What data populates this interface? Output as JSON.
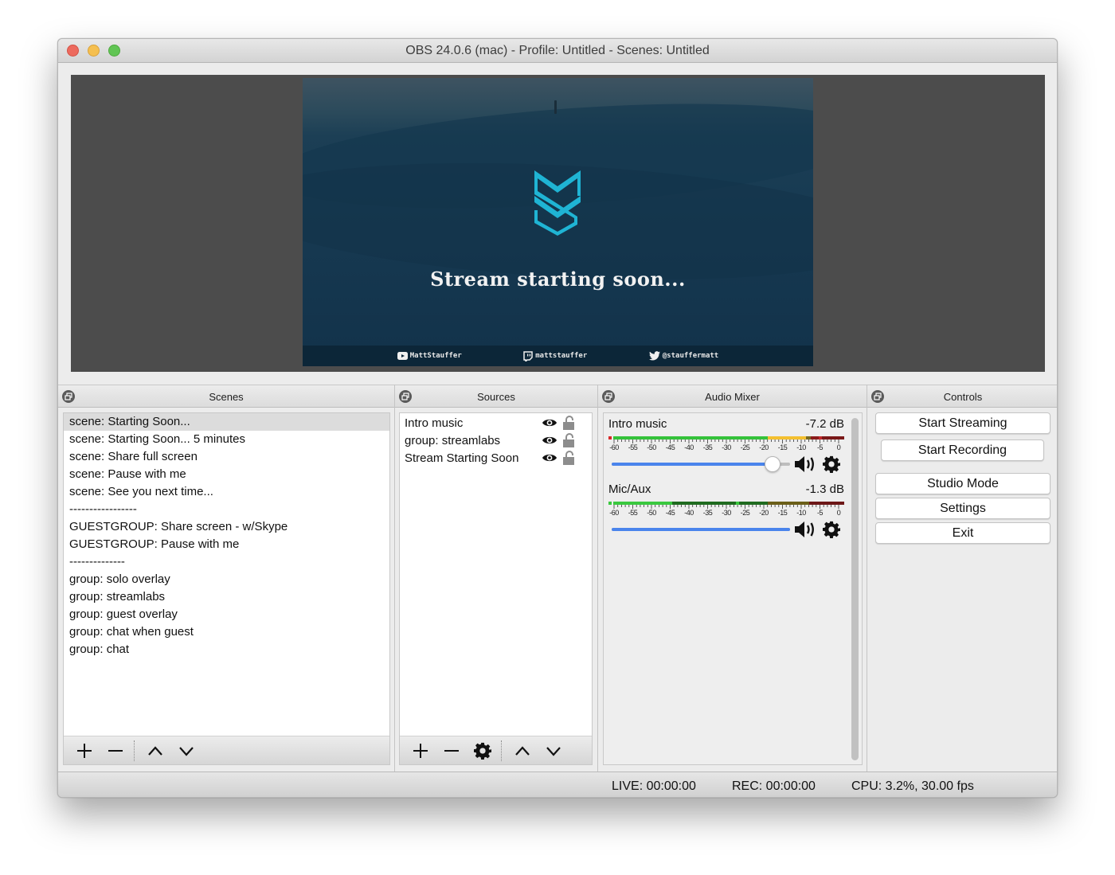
{
  "window": {
    "title": "OBS 24.0.6 (mac) - Profile: Untitled - Scenes: Untitled"
  },
  "preview": {
    "headline": "Stream starting soon...",
    "social": [
      {
        "icon": "youtube-icon",
        "handle": "MattStauffer"
      },
      {
        "icon": "twitch-icon",
        "handle": "mattstauffer"
      },
      {
        "icon": "twitter-icon",
        "handle": "@stauffermatt"
      }
    ],
    "accent_color": "#1fb4d4"
  },
  "scenes": {
    "title": "Scenes",
    "selected_index": 0,
    "items": [
      "scene: Starting Soon...",
      "scene: Starting Soon... 5 minutes",
      "scene: Share full screen",
      "scene: Pause with me",
      "scene: See you next time...",
      "-----------------",
      "GUESTGROUP: Share screen - w/Skype",
      "GUESTGROUP: Pause with me",
      "--------------",
      "group: solo overlay",
      "group: streamlabs",
      "group: guest overlay",
      "group: chat when guest",
      "group: chat"
    ],
    "toolbar": [
      "add-icon",
      "remove-icon",
      "move-up-icon",
      "move-down-icon"
    ]
  },
  "sources": {
    "title": "Sources",
    "items": [
      {
        "name": "Intro music",
        "visible": true,
        "locked": false
      },
      {
        "name": "group: streamlabs",
        "visible": true,
        "locked": false
      },
      {
        "name": "Stream Starting Soon",
        "visible": true,
        "locked": false
      }
    ],
    "toolbar": [
      "add-icon",
      "remove-icon",
      "properties-icon",
      "move-up-icon",
      "move-down-icon"
    ]
  },
  "mixer": {
    "title": "Audio Mixer",
    "scale_labels": [
      "-60",
      "-55",
      "-50",
      "-45",
      "-40",
      "-35",
      "-30",
      "-25",
      "-20",
      "-15",
      "-10",
      "-5",
      "0"
    ],
    "channels": [
      {
        "name": "Intro music",
        "level": "-7.2 dB",
        "volume_fraction": 0.9,
        "show_knob": true
      },
      {
        "name": "Mic/Aux",
        "level": "-1.3 dB",
        "volume_fraction": 1.0,
        "show_knob": false
      }
    ]
  },
  "controls": {
    "title": "Controls",
    "buttons": [
      "Start Streaming",
      "Start Recording",
      "Studio Mode",
      "Settings",
      "Exit"
    ]
  },
  "status": {
    "live": "LIVE: 00:00:00",
    "rec": "REC: 00:00:00",
    "cpu": "CPU: 3.2%, 30.00 fps"
  }
}
